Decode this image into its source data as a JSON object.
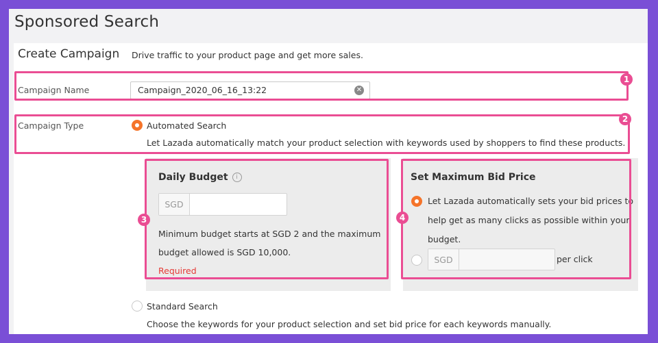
{
  "page_title": "Sponsored Search",
  "create": {
    "title": "Create Campaign",
    "description": "Drive traffic to your product page and get more sales."
  },
  "campaign_name": {
    "label": "Campaign Name",
    "value": "Campaign_2020_06_16_13:22"
  },
  "campaign_type": {
    "label": "Campaign Type",
    "automated": {
      "label": "Automated Search",
      "description": "Let Lazada automatically match your product selection with keywords used by shoppers to find these products."
    },
    "standard": {
      "label": "Standard Search",
      "description": "Choose the keywords for your product selection and set bid price for each keywords manually."
    }
  },
  "daily_budget": {
    "title": "Daily Budget",
    "currency": "SGD",
    "value": "",
    "hint_line1": "Minimum budget starts at SGD 2 and the maximum",
    "hint_line2": "budget allowed is SGD 10,000.",
    "error": "Required"
  },
  "max_bid": {
    "title": "Set Maximum Bid Price",
    "auto_line1": "Let Lazada automatically sets your bid prices to",
    "auto_line2": "help get as many clicks as possible within your",
    "auto_line3": "budget.",
    "currency": "SGD",
    "value": "",
    "per_click": "per click"
  },
  "badges": [
    "1",
    "2",
    "3",
    "4"
  ],
  "colors": {
    "highlight": "#ea4d93",
    "accent_radio": "#f5742a",
    "error": "#e53935",
    "background": "#7a4fd6"
  }
}
